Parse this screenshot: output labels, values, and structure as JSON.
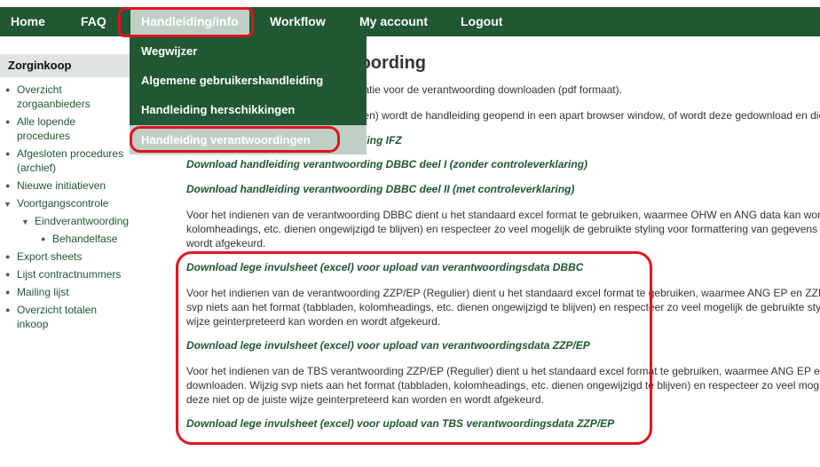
{
  "topnav": {
    "items": [
      {
        "label": "Home"
      },
      {
        "label": "FAQ"
      },
      {
        "label": "Handleiding/info"
      },
      {
        "label": "Workflow"
      },
      {
        "label": "My account"
      },
      {
        "label": "Logout"
      }
    ],
    "active": "Handleiding/info"
  },
  "dropdown": {
    "items": [
      {
        "label": "Wegwijzer"
      },
      {
        "label": "Algemene gebruikershandleiding"
      },
      {
        "label": "Handleiding herschikkingen"
      },
      {
        "label": "Handleiding verantwoordingen"
      }
    ],
    "highlighted": "Handleiding verantwoordingen"
  },
  "sidebar": {
    "title": "Zorginkoop",
    "items": [
      {
        "label": "Overzicht zorgaanbieders",
        "level": 1,
        "icon": "bullet-icon"
      },
      {
        "label": "Alle lopende procedures",
        "level": 1,
        "icon": "bullet-icon"
      },
      {
        "label": "Afgesloten procedures (archief)",
        "level": 1,
        "icon": "bullet-icon"
      },
      {
        "label": "Nieuwe initiatieven",
        "level": 1,
        "icon": "bullet-icon"
      },
      {
        "label": "Voortgangscontrole",
        "level": 1,
        "icon": "triangle-down-icon"
      },
      {
        "label": "Eindverantwoording",
        "level": 2,
        "icon": "triangle-down-icon"
      },
      {
        "label": "Behandelfase",
        "level": 3,
        "icon": "bullet-icon"
      },
      {
        "label": "Export sheets",
        "level": 1,
        "icon": "bullet-icon"
      },
      {
        "label": "Lijst contractnummers",
        "level": 1,
        "icon": "bullet-icon"
      },
      {
        "label": "Mailing lijst",
        "level": 1,
        "icon": "bullet-icon"
      },
      {
        "label": "Overzicht totalen inkoop",
        "level": 1,
        "icon": "bullet-icon"
      }
    ]
  },
  "main": {
    "title": "Handleiding verantwoording",
    "intro1": "Hier kunt u de handleiding met informatie voor de verantwoording downloaden (pdf formaat).",
    "intro2": "Afhankelijk van uw browser (instellingen) wordt de handleiding geopend in een apart browser window, of wordt deze gedownload en dient u deze te openen.",
    "links": {
      "ifz": "Download handleiding verantwoording IFZ",
      "dbbc1": "Download handleiding verantwoording DBBC deel I (zonder controleverklaring)",
      "dbbc2": "Download handleiding verantwoording DBBC deel II (met controleverklaring)",
      "sheet_dbbc": "Download lege invulsheet (excel) voor upload van verantwoordingsdata DBBC",
      "sheet_zzp": "Download lege invulsheet (excel) voor upload van verantwoordingsdata ZZP/EP",
      "sheet_tbs": "Download lege invulsheet (excel) voor upload van TBS verantwoordingsdata ZZP/EP"
    },
    "para_dbbc": [
      "Voor het indienen van de verantwoording DBBC dient u het standaard excel format te gebruiken, waarmee OHW en ANG data kan worden",
      "kolomheadings, etc. dienen ongewijzigd te blijven) en respecteer zo veel mogelijk de gebruikte styling voor formattering van gegevens zodat",
      "wordt afgekeurd."
    ],
    "para_zzp": [
      "Voor het indienen van de verantwoording ZZP/EP (Regulier) dient u het standaard excel format te gebruiken, waarmee ANG EP en ZZP",
      "svp niets aan het format (tabbladen, kolomheadings, etc. dienen ongewijzigd te blijven) en respecteer zo veel mogelijk de gebruikte styling",
      "wijze geinterpreteerd kan worden en wordt afgekeurd."
    ],
    "para_tbs": [
      "Voor het indienen van de TBS verantwoording ZZP/EP (Regulier) dient u het standaard excel format te gebruiken, waarmee ANG EP en",
      "downloaden. Wijzig svp niets aan het format (tabbladen, kolomheadings, etc. dienen ongewijzigd te blijven) en respecteer zo veel mogelijk",
      "deze niet op de juiste wijze geinterpreteerd kan worden en wordt afgekeurd."
    ]
  },
  "colors": {
    "brand_green": "#215732",
    "active_tab": "#bfcfc6",
    "annotation_red": "#e0141e",
    "sidebar_header": "#dde4e2"
  }
}
